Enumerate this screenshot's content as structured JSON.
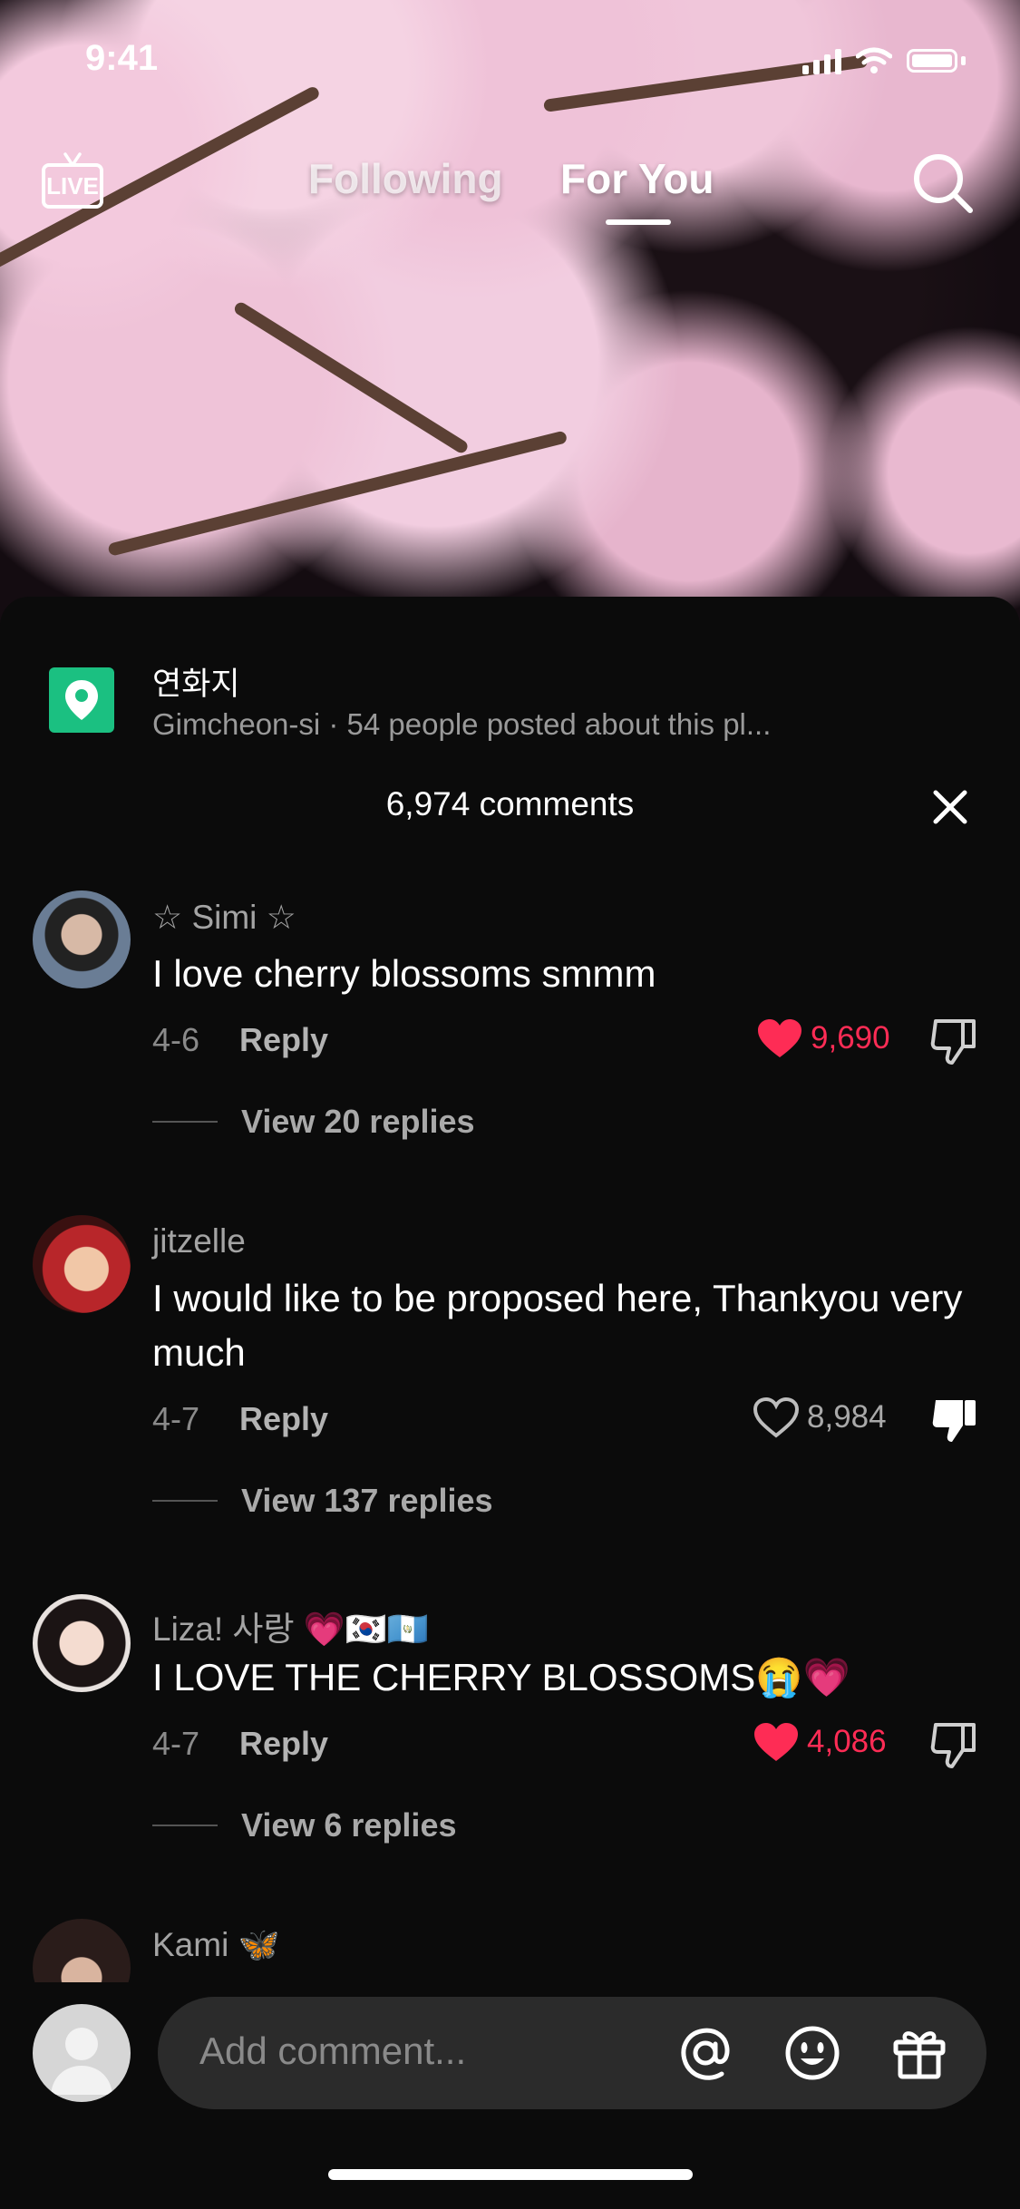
{
  "status": {
    "time": "9:41"
  },
  "nav": {
    "live_label": "LIVE",
    "tabs": [
      {
        "label": "Following"
      },
      {
        "label": "For You"
      }
    ]
  },
  "location": {
    "title": "연화지",
    "subtitle": "Gimcheon-si · 54 people posted about this pl..."
  },
  "comments_header": {
    "count": "6,974 comments"
  },
  "comments": [
    {
      "user": "☆ Simi ☆",
      "text": "I love cherry blossoms smmm",
      "date": "4-6",
      "reply": "Reply",
      "likes": "9,690",
      "liked": true,
      "view_replies": "View 20 replies"
    },
    {
      "user": "jitzelle",
      "text": "I would like to be proposed here, Thankyou very much",
      "date": "4-7",
      "reply": "Reply",
      "likes": "8,984",
      "liked": false,
      "view_replies": "View 137 replies"
    },
    {
      "user": "Liza! 사랑 💗🇰🇷🇬🇹",
      "text": "I LOVE THE CHERRY BLOSSOMS😭💗",
      "date": "4-7",
      "reply": "Reply",
      "likes": "4,086",
      "liked": true,
      "view_replies": "View 6 replies"
    },
    {
      "user": "Kami 🦋"
    }
  ],
  "input": {
    "placeholder": "Add comment..."
  },
  "icons": {
    "live": "live-tv-icon",
    "search": "search-icon",
    "location": "location-pin-icon",
    "close": "close-icon",
    "like": "heart-icon",
    "dislike": "thumbs-down-icon",
    "mention": "at-sign-icon",
    "emoji": "smiley-icon",
    "gift": "gift-icon"
  },
  "colors": {
    "like_red": "#fe2c55",
    "location_green": "#1bc081",
    "sheet_bg": "#0b0b0b"
  }
}
